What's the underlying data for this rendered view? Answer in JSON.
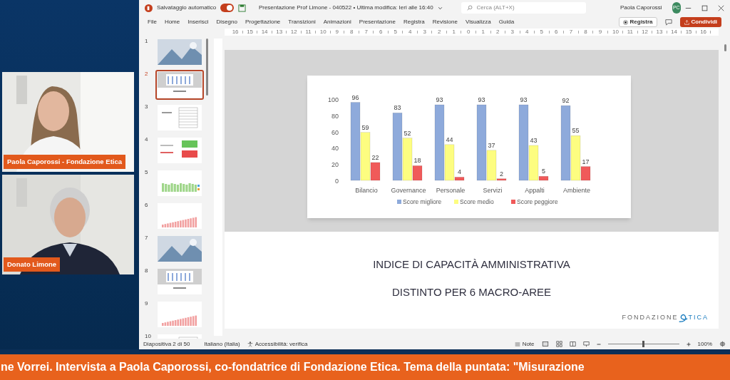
{
  "presenter_panel": {
    "videos": [
      {
        "name": "Paola Caporossi - Fondazione Etica",
        "kind": "woman"
      },
      {
        "name": "Donato Limone",
        "kind": "man"
      }
    ]
  },
  "app": {
    "autosave_label": "Salvataggio automatico",
    "autosave_on": true,
    "document_title": "Presentazione Prof Limone - 040522 • Ultima modifica: Ieri alle 16:40",
    "search": {
      "placeholder": "Cerca (ALT+X)"
    },
    "user_name": "Paola Caporossi",
    "user_initials": "PC",
    "menu": [
      "File",
      "Home",
      "Inserisci",
      "Disegno",
      "Progettazione",
      "Transizioni",
      "Animazioni",
      "Presentazione",
      "Registra",
      "Revisione",
      "Visualizza",
      "Guida"
    ],
    "record_button": "Registra",
    "share_button": "Condividi"
  },
  "ruler": {
    "labels": [
      "16",
      "15",
      "14",
      "13",
      "12",
      "11",
      "10",
      "9",
      "8",
      "7",
      "6",
      "5",
      "4",
      "3",
      "2",
      "1",
      "0",
      "1",
      "2",
      "3",
      "4",
      "5",
      "6",
      "7",
      "8",
      "9",
      "10",
      "11",
      "12",
      "13",
      "14",
      "15",
      "16"
    ]
  },
  "slides_pane": {
    "slides": [
      {
        "number": "1",
        "selected": false
      },
      {
        "number": "2",
        "selected": true,
        "kind": "bar_chart"
      },
      {
        "number": "3",
        "selected": false,
        "kind": "table"
      },
      {
        "number": "4",
        "selected": false,
        "kind": "color_table"
      },
      {
        "number": "5",
        "selected": false,
        "kind": "green_bars"
      },
      {
        "number": "6",
        "selected": false,
        "kind": "red_bars"
      },
      {
        "number": "7",
        "selected": false
      },
      {
        "number": "8",
        "selected": false,
        "kind": "bar_chart"
      },
      {
        "number": "9",
        "selected": false,
        "kind": "red_bars"
      },
      {
        "number": "10",
        "selected": false,
        "kind": "table"
      }
    ]
  },
  "slide": {
    "chart_data": {
      "type": "bar",
      "categories": [
        "Bilancio",
        "Governance",
        "Personale",
        "Servizi",
        "Appalti",
        "Ambiente"
      ],
      "series": [
        {
          "name": "Score migliore",
          "color": "#8eaadb",
          "values": [
            96,
            83,
            93,
            93,
            93,
            92
          ]
        },
        {
          "name": "Score medio",
          "color": "#fdfd80",
          "values": [
            59,
            52,
            44,
            37,
            43,
            55
          ]
        },
        {
          "name": "Score peggiore",
          "color": "#f05a5a",
          "values": [
            22,
            18,
            4,
            2,
            5,
            17
          ]
        }
      ],
      "ylim": [
        0,
        100
      ],
      "yticks": [
        0,
        20,
        40,
        60,
        80,
        100
      ],
      "data_labels": true,
      "legend": true
    },
    "title_lines": [
      "INDICE DI CAPACITÀ AMMINISTRATIVA",
      "DISTINTO PER 6 MACRO-AREE"
    ],
    "logo": {
      "left": "FONDAZIONE",
      "right": "TICA"
    }
  },
  "status_bar": {
    "slide_position": "Diapositiva 2 di 50",
    "language": "Italiano (Italia)",
    "accessibility": "Accessibilità: verifica",
    "notes": "Note",
    "zoom": {
      "level": 0.5,
      "reading": "100%"
    }
  },
  "ticker": {
    "text": "ne Vorrei. Intervista a Paola Caporossi, co-fondatrice di Fondazione Etica. Tema della puntata: \"Misurazione"
  }
}
